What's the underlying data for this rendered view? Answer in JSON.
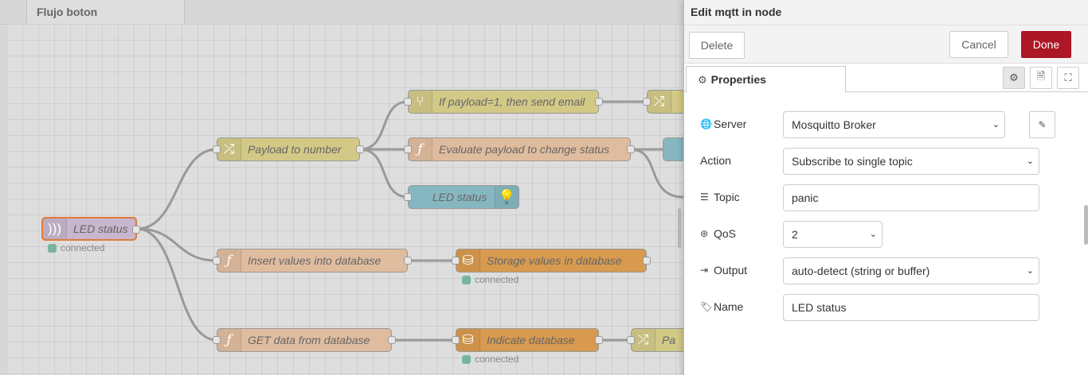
{
  "workspace": {
    "flow_tab_label": "Flujo boton"
  },
  "nodes": [
    {
      "id": "led-status-in",
      "label": "LED status",
      "status": "connected"
    },
    {
      "id": "payload-to-number",
      "label": "Payload to number"
    },
    {
      "id": "if-payload",
      "label": "If payload=1, then send email"
    },
    {
      "id": "evaluate-payload",
      "label": "Evaluate payload to change status"
    },
    {
      "id": "led-status-debug",
      "label": "LED status"
    },
    {
      "id": "insert-values",
      "label": "Insert values into database"
    },
    {
      "id": "storage-values",
      "label": "Storage values in database",
      "status": "connected"
    },
    {
      "id": "get-data",
      "label": "GET data from database"
    },
    {
      "id": "indicate-db",
      "label": "Indicate database",
      "status": "connected"
    },
    {
      "id": "partial-node",
      "label": "Pa"
    }
  ],
  "tray": {
    "title": "Edit mqtt in node",
    "delete_label": "Delete",
    "cancel_label": "Cancel",
    "done_label": "Done",
    "tab_properties": "Properties",
    "done_color": "#ad1625"
  },
  "form": {
    "server": {
      "label": "Server",
      "value": "Mosquitto Broker"
    },
    "action": {
      "label": "Action",
      "value": "Subscribe to single topic"
    },
    "topic": {
      "label": "Topic",
      "value": "panic"
    },
    "qos": {
      "label": "QoS",
      "value": "2"
    },
    "output": {
      "label": "Output",
      "value": "auto-detect (string or buffer)"
    },
    "name": {
      "label": "Name",
      "value": "LED status"
    }
  }
}
